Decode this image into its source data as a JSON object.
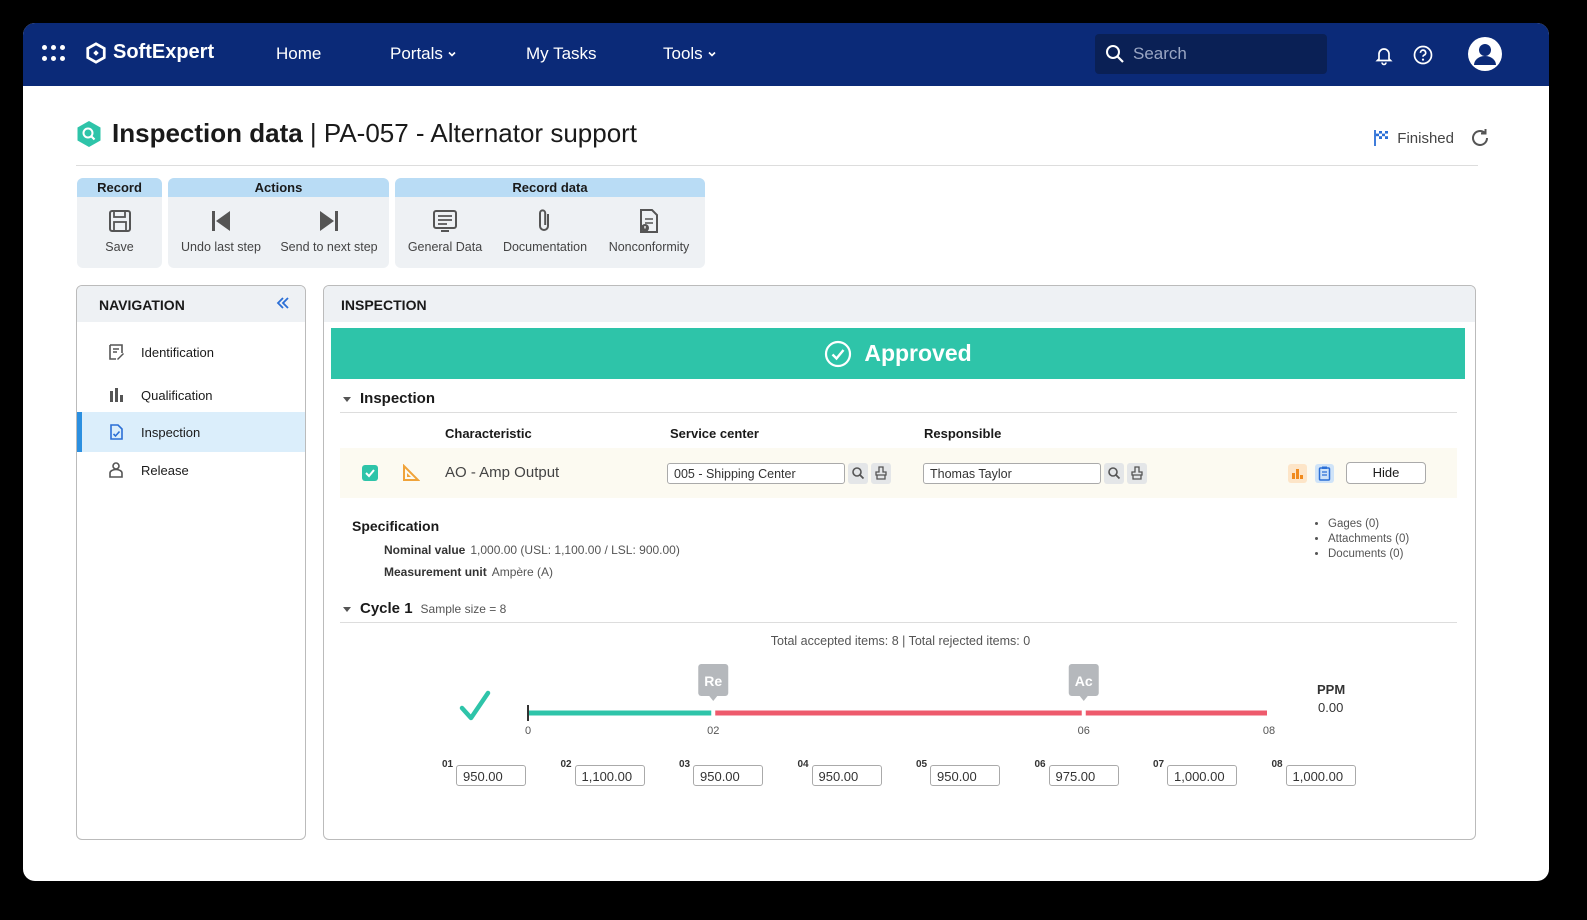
{
  "topbar": {
    "brand": "SoftExpert",
    "nav": [
      {
        "label": "Home",
        "has_menu": false
      },
      {
        "label": "Portals",
        "has_menu": true
      },
      {
        "label": "My Tasks",
        "has_menu": false
      },
      {
        "label": "Tools",
        "has_menu": true
      }
    ],
    "search_placeholder": "Search",
    "icons": [
      "apps-grid-icon",
      "bell-icon",
      "help-icon",
      "user-avatar-icon"
    ]
  },
  "header": {
    "title_bold": "Inspection data",
    "title_rest": " | PA-057 - Alternator support",
    "status": "Finished"
  },
  "ribbon": {
    "record": {
      "title": "Record",
      "buttons": [
        {
          "label": "Save",
          "icon": "save-icon"
        }
      ]
    },
    "actions": {
      "title": "Actions",
      "buttons": [
        {
          "label": "Undo last step",
          "icon": "skip-back-icon"
        },
        {
          "label": "Send to next step",
          "icon": "skip-forward-icon"
        }
      ]
    },
    "record_data": {
      "title": "Record data",
      "buttons": [
        {
          "label": "General Data",
          "icon": "list-icon"
        },
        {
          "label": "Documentation",
          "icon": "paperclip-icon"
        },
        {
          "label": "Nonconformity",
          "icon": "document-alert-icon"
        }
      ]
    }
  },
  "navigation": {
    "title": "NAVIGATION",
    "items": [
      {
        "label": "Identification",
        "icon": "form-icon",
        "active": false
      },
      {
        "label": "Qualification",
        "icon": "bar-chart-icon",
        "active": false
      },
      {
        "label": "Inspection",
        "icon": "checklist-icon",
        "active": true
      },
      {
        "label": "Release",
        "icon": "person-stand-icon",
        "active": false
      }
    ]
  },
  "inspection": {
    "title": "INSPECTION",
    "banner": "Approved",
    "section": "Inspection",
    "columns": {
      "characteristic": "Characteristic",
      "service_center": "Service center",
      "responsible": "Responsible"
    },
    "row": {
      "characteristic": "AO - Amp Output",
      "service_center": "005 - Shipping Center",
      "responsible": "Thomas Taylor",
      "hide_label": "Hide"
    },
    "specification": {
      "title": "Specification",
      "nominal_label": "Nominal value",
      "nominal_value": "1,000.00 (USL: 1,100.00 / LSL: 900.00)",
      "unit_label": "Measurement unit",
      "unit_value": "Ampère (A)"
    },
    "links": [
      "Gages (0)",
      "Attachments (0)",
      "Documents (0)"
    ],
    "cycle": {
      "title": "Cycle 1",
      "sample_size": "Sample size = 8",
      "totals": "Total accepted items: 8 | Total rejected items: 0",
      "ppm_label": "PPM",
      "ppm_value": "0.00"
    }
  },
  "chart_data": {
    "type": "other",
    "axis": {
      "min": 0,
      "max": 8,
      "ticks": [
        "0",
        "02",
        "06",
        "08"
      ]
    },
    "markers": [
      {
        "label": "Re",
        "at": 2
      },
      {
        "label": "Ac",
        "at": 6
      }
    ],
    "segments": [
      {
        "from": 0,
        "to": 2,
        "color": "#2ec4a9"
      },
      {
        "from": 2,
        "to": 6,
        "color": "#ee5a6c"
      },
      {
        "from": 6,
        "to": 8,
        "color": "#ee5a6c"
      }
    ],
    "samples": [
      {
        "n": "01",
        "value": "950.00"
      },
      {
        "n": "02",
        "value": "1,100.00"
      },
      {
        "n": "03",
        "value": "950.00"
      },
      {
        "n": "04",
        "value": "950.00"
      },
      {
        "n": "05",
        "value": "950.00"
      },
      {
        "n": "06",
        "value": "975.00"
      },
      {
        "n": "07",
        "value": "1,000.00"
      },
      {
        "n": "08",
        "value": "1,000.00"
      }
    ]
  }
}
